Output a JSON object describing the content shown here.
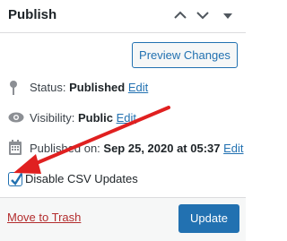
{
  "panel": {
    "title": "Publish",
    "collapse_icon": "chevron-up-icon",
    "expand_icon": "chevron-down-icon",
    "toggle_icon": "triangle-down-icon"
  },
  "preview_button": {
    "label": "Preview Changes"
  },
  "status": {
    "icon": "pin-icon",
    "label": "Status: ",
    "value": "Published",
    "edit": "Edit"
  },
  "visibility": {
    "icon": "eye-icon",
    "label": "Visibility: ",
    "value": "Public",
    "edit": "Edit"
  },
  "published_on": {
    "icon": "calendar-icon",
    "label": "Published on: ",
    "value": "Sep 25, 2020 at 05:37",
    "edit": "Edit"
  },
  "csv_option": {
    "label": "Disable CSV Updates",
    "checked": true
  },
  "footer": {
    "trash_link": "Move to Trash",
    "update_button": "Update"
  },
  "colors": {
    "accent": "#2271b1",
    "trash": "#b32d2e",
    "annotation_arrow": "#e02020"
  }
}
